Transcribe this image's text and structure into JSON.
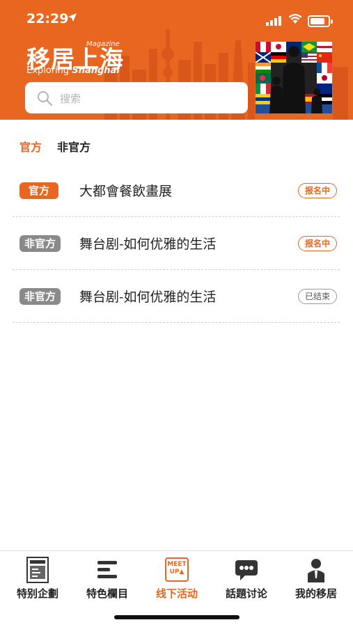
{
  "status_bar": {
    "time": "22:29",
    "location_icon": "location-arrow-icon",
    "signal_icon": "signal-icon",
    "wifi_icon": "wifi-icon",
    "battery_icon": "battery-icon"
  },
  "header": {
    "logo_cn": "移居上海",
    "logo_magazine": "Magazine",
    "logo_en_1": "Exploring",
    "logo_en_2": "Shanghai",
    "search_placeholder": "搜索",
    "banner_image": "flags-people-image",
    "accent_color": "#e8661f"
  },
  "filter": {
    "tabs": [
      {
        "label": "官方",
        "active": true
      },
      {
        "label": "非官方",
        "active": false
      }
    ]
  },
  "events": [
    {
      "tag": "官方",
      "title": "大都會餐飲畫展",
      "status": "报名中"
    },
    {
      "tag": "非官方",
      "title": "舞台剧-如何优雅的生活",
      "status": "报名中"
    },
    {
      "tag": "非官方",
      "title": "舞台剧-如何优雅的生活",
      "status": "已结束"
    }
  ],
  "tabbar": {
    "items": [
      {
        "label": "特别企劃",
        "icon": "magazine-cover-icon",
        "active": false
      },
      {
        "label": "特色欄目",
        "icon": "list-lines-icon",
        "active": false
      },
      {
        "label": "线下活动",
        "icon": "meetup-icon",
        "active": true,
        "icon_text_1": "MEET",
        "icon_text_2": "UP▲"
      },
      {
        "label": "話題讨论",
        "icon": "chat-bubble-icon",
        "active": false
      },
      {
        "label": "我的移居",
        "icon": "user-icon",
        "active": false
      }
    ]
  }
}
